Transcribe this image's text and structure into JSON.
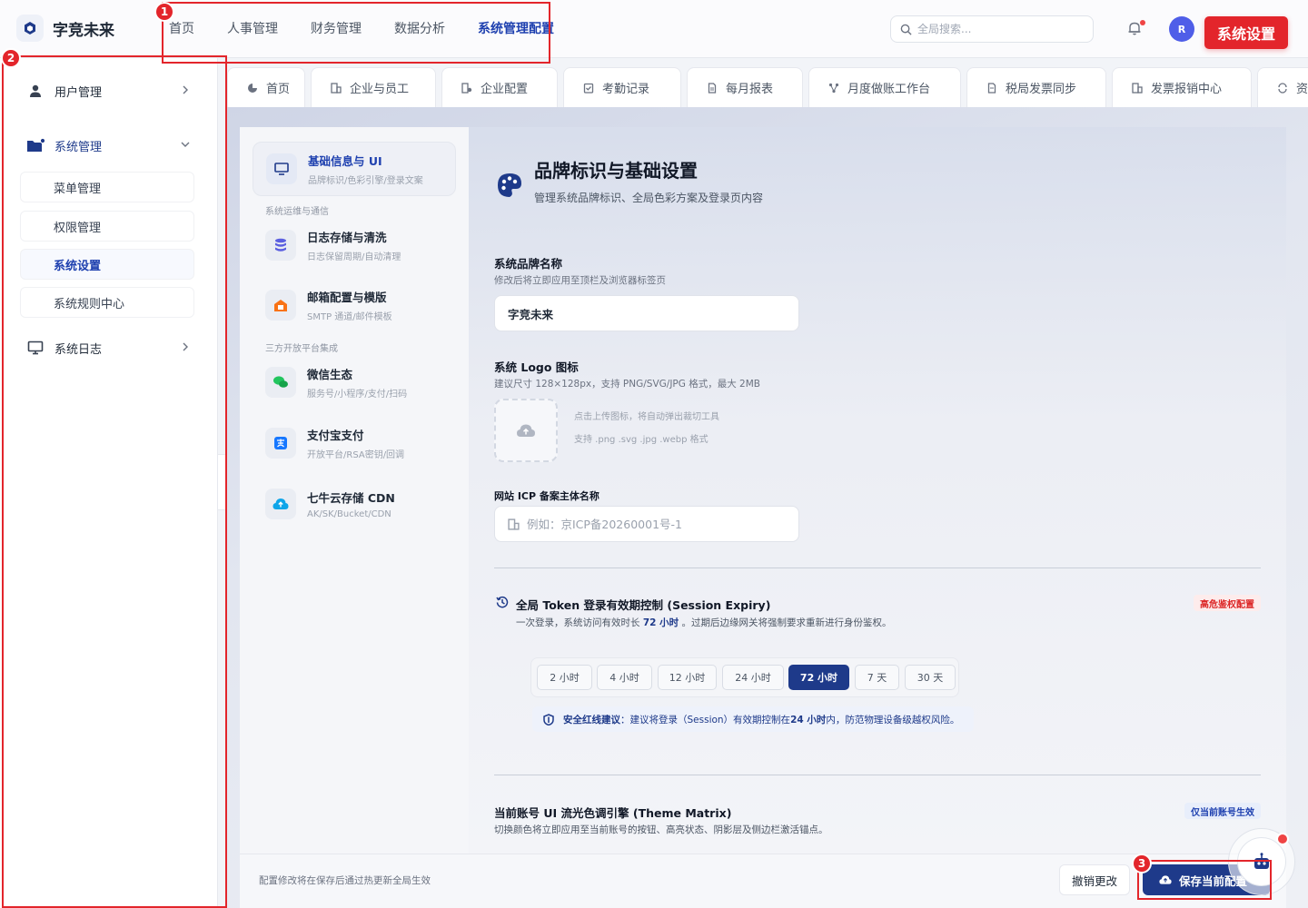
{
  "header": {
    "brand": "字竞未来",
    "nav": [
      "首页",
      "人事管理",
      "财务管理",
      "数据分析",
      "系统管理配置"
    ],
    "search_placeholder": "全局搜索...",
    "avatar_initial": "R",
    "system_tag": "系统设置"
  },
  "sidebar": {
    "user_mgmt": "用户管理",
    "sys_mgmt": "系统管理",
    "sub_items": [
      "菜单管理",
      "权限管理",
      "系统设置",
      "系统规则中心"
    ],
    "sys_log": "系统日志"
  },
  "tabs": [
    "首页",
    "企业与员工",
    "企业配置",
    "考勤记录",
    "每月报表",
    "月度做账工作台",
    "税局发票同步",
    "发票报销中心",
    "资料"
  ],
  "settings_nav": {
    "active": {
      "title": "基础信息与 UI",
      "sub": "品牌标识/色彩引擎/登录文案"
    },
    "group1": "系统运维与通信",
    "log": {
      "title": "日志存储与清洗",
      "sub": "日志保留周期/自动清理"
    },
    "mail": {
      "title": "邮箱配置与模版",
      "sub": "SMTP 通道/邮件模板"
    },
    "group2": "三方开放平台集成",
    "wechat": {
      "title": "微信生态",
      "sub": "服务号/小程序/支付/扫码"
    },
    "alipay": {
      "title": "支付宝支付",
      "sub": "开放平台/RSA密钥/回调"
    },
    "qiniu": {
      "title": "七牛云存储 CDN",
      "sub": "AK/SK/Bucket/CDN"
    }
  },
  "panel": {
    "title": "品牌标识与基础设置",
    "subtitle": "管理系统品牌标识、全局色彩方案及登录页内容",
    "brand_label": "系统品牌名称",
    "brand_hint": "修改后将立即应用至顶栏及浏览器标签页",
    "brand_value": "字竞未来",
    "logo_label": "系统 Logo 图标",
    "logo_hint": "建议尺寸 128×128px，支持 PNG/SVG/JPG 格式，最大 2MB",
    "upload_hint1": "点击上传图标，将自动弹出裁切工具",
    "upload_hint2": "支持 .png .svg .jpg .webp 格式",
    "icp_label": "网站 ICP 备案主体名称",
    "icp_placeholder": "例如：京ICP备20260001号-1",
    "token_title": "全局 Token 登录有效期控制 (Session Expiry)",
    "token_sub_pre": "一次登录，系统访问有效时长 ",
    "token_sub_bold": "72 小时",
    "token_sub_post": " 。过期后边缘网关将强制要求重新进行身份鉴权。",
    "token_badge": "高危鉴权配置",
    "durations": [
      "2 小时",
      "4 小时",
      "12 小时",
      "24 小时",
      "72 小时",
      "7 天",
      "30 天"
    ],
    "active_duration": "72 小时",
    "advice_bold": "安全红线建议",
    "advice_pre": "：建议将登录（Session）有效期控制在 ",
    "advice_b2": "24 小时",
    "advice_post": " 内，防范物理设备级越权风险。",
    "theme_title": "当前账号 UI 流光色调引擎 (Theme Matrix)",
    "theme_sub": "切换颜色将立即应用至当前账号的按钮、高亮状态、阴影层及侧边栏激活锚点。",
    "theme_badge": "仅当前账号生效"
  },
  "footer": {
    "hint": "配置修改将在保存后通过热更新全局生效",
    "cancel": "撤销更改",
    "save": "保存当前配置"
  },
  "annotations": [
    "1",
    "2",
    "3"
  ],
  "colors": {
    "accent": "#1e3a8a",
    "annotation": "#e3252b",
    "danger": "#dc2626"
  }
}
